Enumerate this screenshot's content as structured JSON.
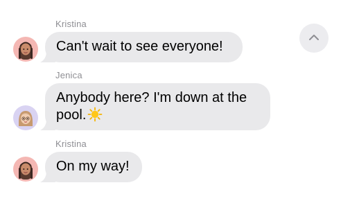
{
  "messages": [
    {
      "sender": "Kristina",
      "text": "Can't wait to see everyone!",
      "avatar": "kristina-memoji-avatar"
    },
    {
      "sender": "Jenica",
      "text_line1": "Anybody here? I'm down at the",
      "text_line2": "pool.",
      "emoji": "sun-emoji",
      "avatar": "jenica-memoji-avatar"
    },
    {
      "sender": "Kristina",
      "text": "On my way!",
      "avatar": "kristina-memoji-avatar"
    }
  ],
  "controls": {
    "scroll_up_icon": "chevron-up-icon"
  },
  "colors": {
    "bubble": "#e9e9eb",
    "sender_label": "#8e8e93",
    "kristina_avatar_bg": "#f4b7b3",
    "jenica_avatar_bg": "#d9d3f2"
  }
}
